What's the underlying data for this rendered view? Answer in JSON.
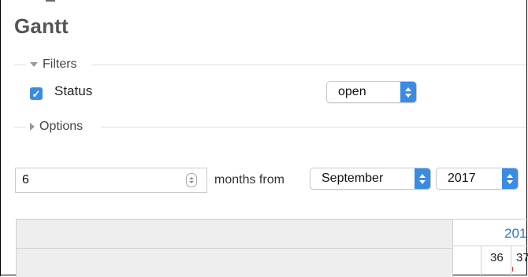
{
  "page": {
    "title": "Gantt"
  },
  "filters": {
    "legend": "Filters",
    "status": {
      "label": "Status",
      "checked": true,
      "operator": "open"
    }
  },
  "options": {
    "legend": "Options"
  },
  "range": {
    "months": "6",
    "months_from_label": "months from",
    "month": "September",
    "year": "2017"
  },
  "gantt": {
    "year_header": "201",
    "weeks": [
      "36",
      "37"
    ]
  },
  "colors": {
    "accent": "#3a8be3",
    "link": "#2a7bbf",
    "today": "#dd3333"
  }
}
